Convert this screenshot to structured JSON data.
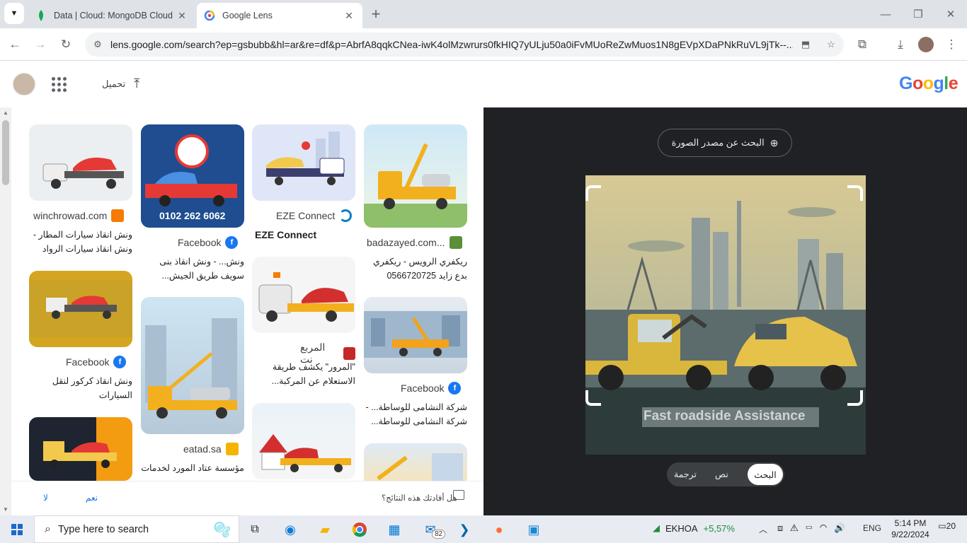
{
  "browser": {
    "tabs": [
      {
        "title": "Data | Cloud: MongoDB Cloud",
        "icon": "mongodb-leaf-icon",
        "active": false
      },
      {
        "title": "Google Lens",
        "icon": "google-lens-icon",
        "active": true
      }
    ],
    "url": "lens.google.com/search?ep=gsbubb&hl=ar&re=df&p=AbrfA8qqkCNea-iwK4olMzwrurs0fkHIQ7yULju50a0iFvMUoReZwMuos1N8gEVpXDaPNkRuVL9jTk--..."
  },
  "lens": {
    "upload_label": "تحميل",
    "logo": "Google",
    "find_source_label": "البحث عن مصدر الصورة",
    "image_caption": "Fast roadside Assistance",
    "mode_tabs": [
      "البحث",
      "نص",
      "ترجمة"
    ],
    "feedback_question": "هل أفادتك هذه النتائج؟",
    "yes_label": "نعم",
    "no_label": "لا"
  },
  "results": {
    "col1": [
      {
        "source": "badazayed.com...",
        "desc": "ريكفري الرويس - ريكفري بدع زايد 0566720725"
      },
      {
        "source": "Facebook",
        "desc": "شركة النشامى للوساطة... - شركة النشامى للوساطة..."
      }
    ],
    "col2": [
      {
        "source": "EZE Connect",
        "desc": "EZE Connect"
      },
      {
        "source": "المربع نت",
        "desc": "\"المرور\" يكشف طريقة الاستعلام عن المركبة..."
      }
    ],
    "col3": [
      {
        "source": "Facebook",
        "desc": "ونش... - ونش انقاذ بنى سويف طريق الجيش..."
      },
      {
        "source": "eatad.sa",
        "desc": "مؤسسة عتاد المورد لخدمات"
      }
    ],
    "col4": [
      {
        "source": "winchrowad.com",
        "desc": "ونش انقاذ سيارات المطار - ونش انقاذ سيارات الرواد"
      },
      {
        "source": "Facebook",
        "desc": "ونش انقاذ كركور لنقل السيارات"
      }
    ],
    "phone_on_image": "0102 262 6062"
  },
  "taskbar": {
    "search_placeholder": "Type here to search",
    "mail_badge": "82",
    "stock_name": "EKHOA",
    "stock_change": "+5,57%",
    "lang": "ENG",
    "time": "5:14 PM",
    "date": "9/22/2024",
    "notif_count": "20"
  },
  "colors": {
    "stock_green": "#1e8e3e",
    "accent_blue": "#1a73e8"
  }
}
